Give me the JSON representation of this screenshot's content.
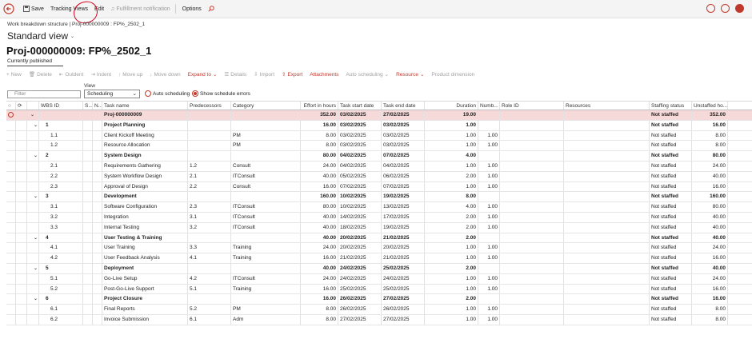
{
  "colors": {
    "accent": "#c0392b",
    "selected_row": "#f6dada",
    "annotation": "#d6001c"
  },
  "toolbar": {
    "save": "Save",
    "tracking_views": "Tracking Views",
    "edit": "Edit",
    "fulfillment": "Fulfillment notification",
    "options": "Options"
  },
  "breadcrumb": "Work breakdown structure  |  Proj-000000009 : FP%_2502_1",
  "view_title": "Standard view",
  "page_title": "Proj-000000009: FP%_2502_1",
  "status": "Currently published",
  "gridbar": {
    "new": "New",
    "delete": "Delete",
    "outdent": "Outdent",
    "indent": "Indent",
    "move_up": "Move up",
    "move_down": "Move down",
    "expand_to": "Expand to",
    "details": "Details",
    "import": "Import",
    "export": "Export",
    "attachments": "Attachments",
    "auto_scheduling": "Auto scheduling",
    "resource": "Resource",
    "product_dimension": "Product dimension"
  },
  "filter": {
    "placeholder": "Filter"
  },
  "view": {
    "label": "View",
    "selected": "Scheduling"
  },
  "options": {
    "auto_scheduling": "Auto scheduling",
    "show_errors": "Show schedule errors"
  },
  "columns": {
    "wbs": "WBS ID",
    "s": "S...",
    "n": "N...",
    "task": "Task name",
    "pred": "Predecessors",
    "cat": "Category",
    "effort": "Effort in hours",
    "start": "Task start date",
    "end": "Task end date",
    "duration": "Duration",
    "number": "Numb...",
    "role": "Role ID",
    "resources": "Resources",
    "staffing": "Staffing status",
    "unstaffed": "Unstaffed ho..."
  },
  "rows": [
    {
      "wbs": "",
      "task": "Proj-000000009",
      "pred": "",
      "cat": "",
      "effort": "352.00",
      "start": "03/02/2025",
      "end": "27/02/2025",
      "duration": "19.00",
      "num": "",
      "staff": "Not staffed",
      "unstaffed": "352.00",
      "level": 0,
      "bold": true,
      "selected": true
    },
    {
      "wbs": "1",
      "task": "Project Planning",
      "pred": "",
      "cat": "",
      "effort": "16.00",
      "start": "03/02/2025",
      "end": "03/02/2025",
      "duration": "1.00",
      "num": "",
      "staff": "Not staffed",
      "unstaffed": "16.00",
      "level": 1,
      "bold": true
    },
    {
      "wbs": "1.1",
      "task": "Client Kickoff Meeting",
      "pred": "",
      "cat": "PM",
      "effort": "8.00",
      "start": "03/02/2025",
      "end": "03/02/2025",
      "duration": "1.00",
      "num": "1.00",
      "staff": "Not staffed",
      "unstaffed": "8.00",
      "level": 2
    },
    {
      "wbs": "1.2",
      "task": "Resource Allocation",
      "pred": "",
      "cat": "PM",
      "effort": "8.00",
      "start": "03/02/2025",
      "end": "03/02/2025",
      "duration": "1.00",
      "num": "1.00",
      "staff": "Not staffed",
      "unstaffed": "8.00",
      "level": 2
    },
    {
      "wbs": "2",
      "task": "System Design",
      "pred": "",
      "cat": "",
      "effort": "80.00",
      "start": "04/02/2025",
      "end": "07/02/2025",
      "duration": "4.00",
      "num": "",
      "staff": "Not staffed",
      "unstaffed": "80.00",
      "level": 1,
      "bold": true
    },
    {
      "wbs": "2.1",
      "task": "Requirements Gathering",
      "pred": "1.2",
      "cat": "Consult",
      "effort": "24.00",
      "start": "04/02/2025",
      "end": "04/02/2025",
      "duration": "1.00",
      "num": "1.00",
      "staff": "Not staffed",
      "unstaffed": "24.00",
      "level": 2
    },
    {
      "wbs": "2.2",
      "task": "System Workflow Design",
      "pred": "2.1",
      "cat": "ITConsult",
      "effort": "40.00",
      "start": "05/02/2025",
      "end": "06/02/2025",
      "duration": "2.00",
      "num": "1.00",
      "staff": "Not staffed",
      "unstaffed": "40.00",
      "level": 2
    },
    {
      "wbs": "2.3",
      "task": "Approval of Design",
      "pred": "2.2",
      "cat": "Consult",
      "effort": "16.00",
      "start": "07/02/2025",
      "end": "07/02/2025",
      "duration": "1.00",
      "num": "1.00",
      "staff": "Not staffed",
      "unstaffed": "16.00",
      "level": 2
    },
    {
      "wbs": "3",
      "task": "Development",
      "pred": "",
      "cat": "",
      "effort": "160.00",
      "start": "10/02/2025",
      "end": "19/02/2025",
      "duration": "8.00",
      "num": "",
      "staff": "Not staffed",
      "unstaffed": "160.00",
      "level": 1,
      "bold": true
    },
    {
      "wbs": "3.1",
      "task": "Software Configuration",
      "pred": "2.3",
      "cat": "ITConsult",
      "effort": "80.00",
      "start": "10/02/2025",
      "end": "13/02/2025",
      "duration": "4.00",
      "num": "1.00",
      "staff": "Not staffed",
      "unstaffed": "80.00",
      "level": 2
    },
    {
      "wbs": "3.2",
      "task": "Integration",
      "pred": "3.1",
      "cat": "ITConsult",
      "effort": "40.00",
      "start": "14/02/2025",
      "end": "17/02/2025",
      "duration": "2.00",
      "num": "1.00",
      "staff": "Not staffed",
      "unstaffed": "40.00",
      "level": 2
    },
    {
      "wbs": "3.3",
      "task": "Internal Testing",
      "pred": "3.2",
      "cat": "ITConsult",
      "effort": "40.00",
      "start": "18/02/2025",
      "end": "19/02/2025",
      "duration": "2.00",
      "num": "1.00",
      "staff": "Not staffed",
      "unstaffed": "40.00",
      "level": 2
    },
    {
      "wbs": "4",
      "task": "User Testing & Training",
      "pred": "",
      "cat": "",
      "effort": "40.00",
      "start": "20/02/2025",
      "end": "21/02/2025",
      "duration": "2.00",
      "num": "",
      "staff": "Not staffed",
      "unstaffed": "40.00",
      "level": 1,
      "bold": true
    },
    {
      "wbs": "4.1",
      "task": "User Training",
      "pred": "3.3",
      "cat": "Training",
      "effort": "24.00",
      "start": "20/02/2025",
      "end": "20/02/2025",
      "duration": "1.00",
      "num": "1.00",
      "staff": "Not staffed",
      "unstaffed": "24.00",
      "level": 2
    },
    {
      "wbs": "4.2",
      "task": "User Feedback Analysis",
      "pred": "4.1",
      "cat": "Training",
      "effort": "16.00",
      "start": "21/02/2025",
      "end": "21/02/2025",
      "duration": "1.00",
      "num": "1.00",
      "staff": "Not staffed",
      "unstaffed": "16.00",
      "level": 2
    },
    {
      "wbs": "5",
      "task": "Deployment",
      "pred": "",
      "cat": "",
      "effort": "40.00",
      "start": "24/02/2025",
      "end": "25/02/2025",
      "duration": "2.00",
      "num": "",
      "staff": "Not staffed",
      "unstaffed": "40.00",
      "level": 1,
      "bold": true
    },
    {
      "wbs": "5.1",
      "task": "Go-Live Setup",
      "pred": "4.2",
      "cat": "ITConsult",
      "effort": "24.00",
      "start": "24/02/2025",
      "end": "24/02/2025",
      "duration": "1.00",
      "num": "1.00",
      "staff": "Not staffed",
      "unstaffed": "24.00",
      "level": 2
    },
    {
      "wbs": "5.2",
      "task": "Post-Go-Live Support",
      "pred": "5.1",
      "cat": "Training",
      "effort": "16.00",
      "start": "25/02/2025",
      "end": "25/02/2025",
      "duration": "1.00",
      "num": "1.00",
      "staff": "Not staffed",
      "unstaffed": "16.00",
      "level": 2
    },
    {
      "wbs": "6",
      "task": "Project Closure",
      "pred": "",
      "cat": "",
      "effort": "16.00",
      "start": "26/02/2025",
      "end": "27/02/2025",
      "duration": "2.00",
      "num": "",
      "staff": "Not staffed",
      "unstaffed": "16.00",
      "level": 1,
      "bold": true
    },
    {
      "wbs": "6.1",
      "task": "Final Reports",
      "pred": "5.2",
      "cat": "PM",
      "effort": "8.00",
      "start": "26/02/2025",
      "end": "26/02/2025",
      "duration": "1.00",
      "num": "1.00",
      "staff": "Not staffed",
      "unstaffed": "8.00",
      "level": 2
    },
    {
      "wbs": "6.2",
      "task": "Invoice Submission",
      "pred": "6.1",
      "cat": "Adm",
      "effort": "8.00",
      "start": "27/02/2025",
      "end": "27/02/2025",
      "duration": "1.00",
      "num": "1.00",
      "staff": "Not staffed",
      "unstaffed": "8.00",
      "level": 2
    }
  ]
}
